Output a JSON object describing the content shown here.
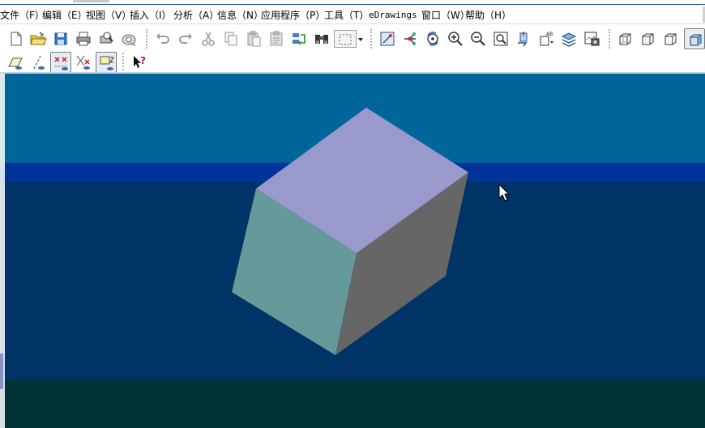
{
  "menubar": {
    "items": [
      {
        "label": "文件（F）"
      },
      {
        "label": "编辑（E）"
      },
      {
        "label": "视图（V）"
      },
      {
        "label": "插入（I）"
      },
      {
        "label": "分析（A）"
      },
      {
        "label": "信息（N）"
      },
      {
        "label": "应用程序（P）"
      },
      {
        "label": "工具（T）"
      },
      {
        "label": "eDrawings"
      },
      {
        "label": "窗口（W）"
      },
      {
        "label": "帮助（H）"
      }
    ]
  },
  "toolbar": {
    "row1_icons": [
      "new-file-icon",
      "open-folder-icon",
      "save-icon",
      "print-icon",
      "print-preview-icon",
      "send-mail-icon",
      "undo-icon",
      "redo-icon",
      "cut-icon",
      "copy-icon",
      "paste-icon",
      "paste-special-icon",
      "regenerate-icon",
      "find-binoculars-icon",
      "select-box-icon",
      "dropdown-arrow-icon",
      "smart-select-icon",
      "point-filter-icon",
      "rotate-view-icon",
      "zoom-in-icon",
      "zoom-out-icon",
      "zoom-window-icon",
      "pan-view-icon",
      "view-name-icon",
      "layers-icon",
      "snapshot-icon",
      "wireframe-view-icon",
      "hidden-lines-view-icon",
      "no-hidden-lines-view-icon",
      "shaded-view-icon"
    ],
    "row2_icons": [
      "plane-filter-icon",
      "axis-filter-icon",
      "point-filter-eye-icon",
      "intersection-filter-icon",
      "note-filter-icon",
      "whats-this-help-icon"
    ]
  },
  "viewport": {
    "colors": {
      "sky": "#006699",
      "horizon": "#003399",
      "floor": "#003366",
      "ground": "#003333",
      "cube_top": "#9999cc",
      "cube_left": "#669999",
      "cube_right": "#666666"
    }
  }
}
